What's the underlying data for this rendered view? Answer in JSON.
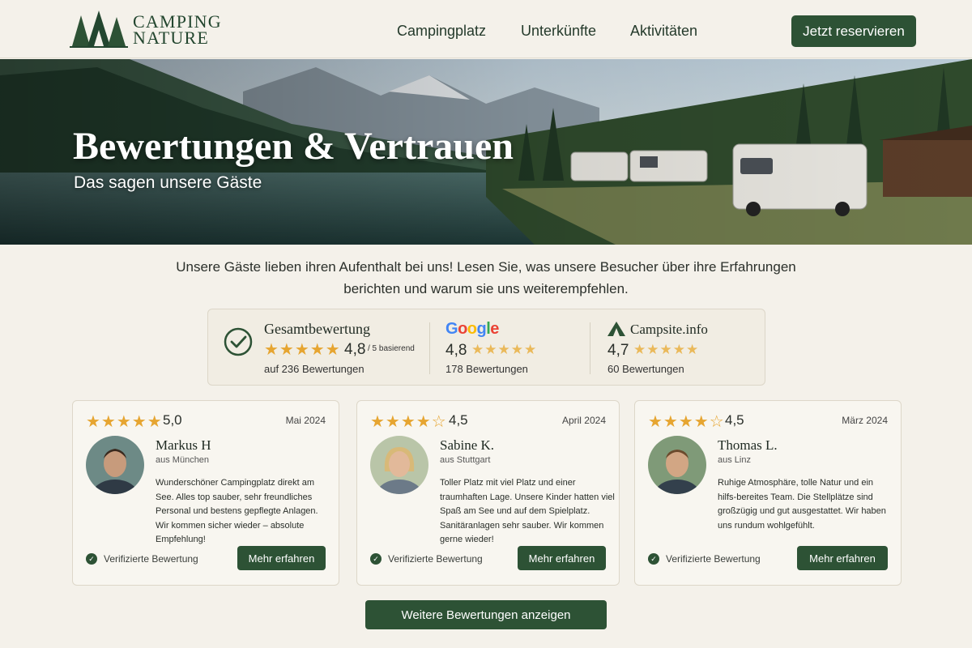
{
  "header": {
    "logo_line1": "CAMPING",
    "logo_line2": "NATURE",
    "nav": [
      "Campingplatz",
      "Unterkünfte",
      "Aktivitäten"
    ],
    "cta": "Jetzt reservieren"
  },
  "hero": {
    "title": "Bewertungen & Vertrauen",
    "subtitle": "Das sagen unsere Gäste"
  },
  "intro": "Unsere Gäste lieben ihren Aufenthalt bei uns! Lesen Sie, was unsere Besucher über ihre Erfahrungen berichten und warum sie uns weiterempfehlen.",
  "summary": {
    "overall": {
      "title": "Gesamtbewertung",
      "stars": "★★★★★",
      "score": "4,8",
      "scale": "/ 5 basierend",
      "count": "auf 236 Bewertungen"
    },
    "google": {
      "label": "Google",
      "score": "4,8",
      "stars": "★★★★★",
      "count": "178 Bewertungen"
    },
    "campsite": {
      "label": "Campsite.info",
      "score": "4,7",
      "stars": "★★★★★",
      "count": "60 Bewertungen"
    }
  },
  "reviews": [
    {
      "stars": "★★★★★",
      "rating": "5,0",
      "date": "Mai 2024",
      "name": "Markus H",
      "from": "aus München",
      "text": "Wunderschöner Campingplatz direkt am See. Alles top sauber, sehr freundliches Personal und bestens gepflegte Anlagen. Wir kommen sicher wieder – absolute Empfehlung!",
      "verified": "Verifizierte Bewertung",
      "more": "Mehr erfahren"
    },
    {
      "stars": "★★★★☆",
      "rating": "4,5",
      "date": "April 2024",
      "name": "Sabine K.",
      "from": "aus Stuttgart",
      "text": "Toller Platz mit viel Platz und einer traumhaften Lage. Unsere Kinder hatten viel Spaß am See und auf dem Spielplatz. Sanitäranlagen sehr sauber. Wir kommen gerne wieder!",
      "verified": "Verifizierte Bewertung",
      "more": "Mehr erfahren"
    },
    {
      "stars": "★★★★☆",
      "rating": "4,5",
      "date": "März 2024",
      "name": "Thomas L.",
      "from": "aus Linz",
      "text": "Ruhige Atmosphäre, tolle Natur und ein hilfs-bereites Team. Die Stellplätze sind großzügig und gut ausgestattet. Wir haben uns rundum wohlgefühlt.",
      "verified": "Verifizierte Bewertung",
      "more": "Mehr erfahren"
    }
  ],
  "more_reviews": "Weitere Bewertungen anzeigen",
  "colors": {
    "primary": "#2d5235",
    "star": "#e6a531",
    "background": "#f4f1ea"
  }
}
